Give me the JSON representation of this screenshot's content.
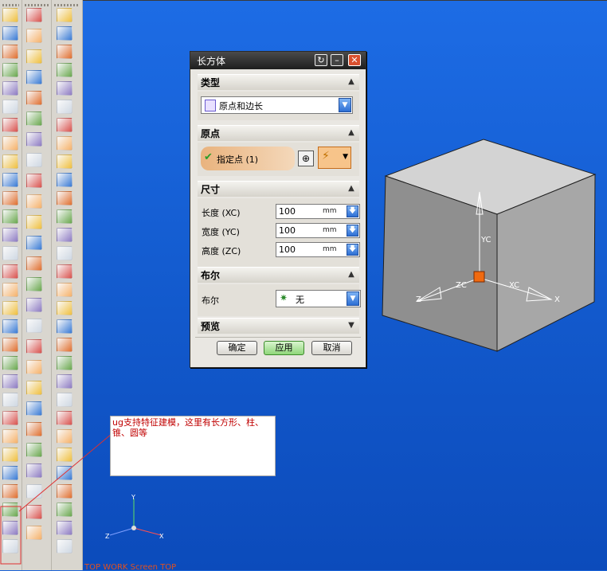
{
  "dialog": {
    "title": "长方体",
    "sections": {
      "type": {
        "header": "类型",
        "selected": "原点和边长"
      },
      "origin": {
        "header": "原点",
        "specify_point": "指定点 (1)"
      },
      "dimensions": {
        "header": "尺寸",
        "rows": [
          {
            "label": "长度 (XC)",
            "value": "100",
            "unit": "mm"
          },
          {
            "label": "宽度 (YC)",
            "value": "100",
            "unit": "mm"
          },
          {
            "label": "高度 (ZC)",
            "value": "100",
            "unit": "mm"
          }
        ]
      },
      "boolean": {
        "header": "布尔",
        "label": "布尔",
        "selected": "无"
      },
      "preview": {
        "header": "预览"
      }
    },
    "buttons": {
      "ok": "确定",
      "apply": "应用",
      "cancel": "取消"
    }
  },
  "annotation": {
    "text": "ug支持特征建模，这里有长方形、柱、锥、圆等"
  },
  "viewport": {
    "axes_labels": {
      "yc": "YC",
      "zc": "ZC",
      "xc": "XC",
      "x": "X",
      "z": "Z"
    },
    "triad_labels": {
      "y": "Y",
      "z": "Z",
      "x": "X"
    },
    "watermark": "TOP WORK Screen TOP"
  }
}
